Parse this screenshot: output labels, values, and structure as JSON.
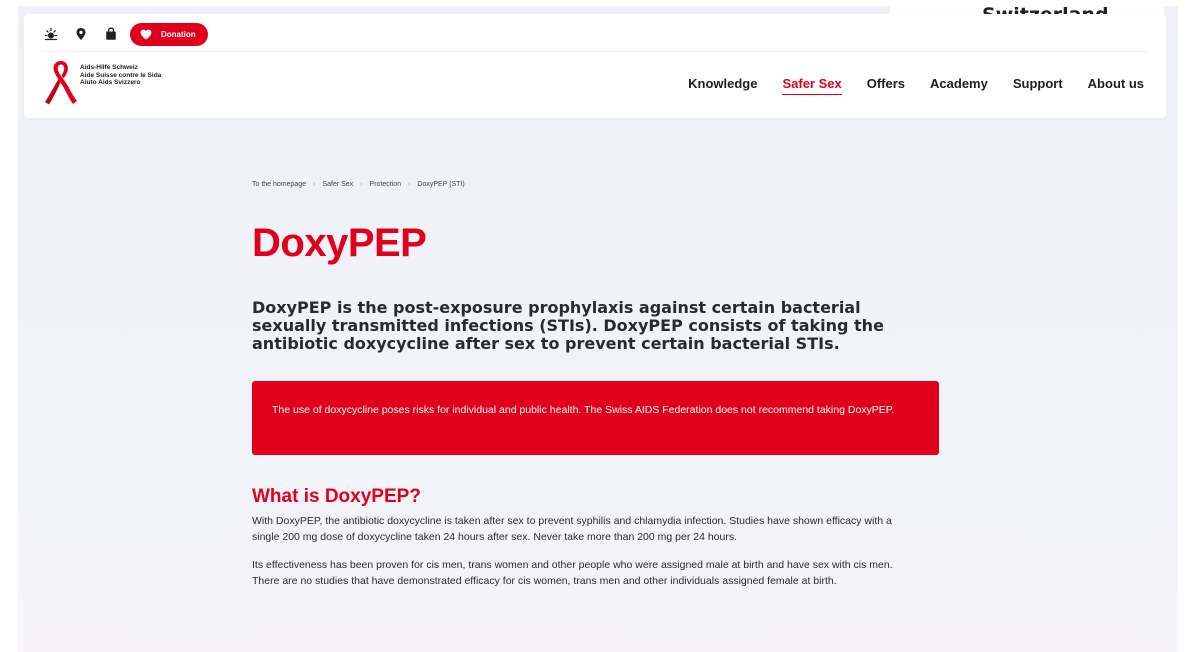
{
  "corner": {
    "label": "Switzerland"
  },
  "header": {
    "utility": {
      "icons": [
        "sun-icon",
        "location-pin-icon",
        "shopping-bag-icon"
      ],
      "donation_label": "Donation"
    },
    "logo": {
      "lines": [
        "Aids-Hilfe Schweiz",
        "Aide Suisse contre le Sida",
        "Aiuto Aids Svizzero"
      ]
    },
    "nav": [
      {
        "label": "Knowledge",
        "active": false
      },
      {
        "label": "Safer Sex",
        "active": true
      },
      {
        "label": "Offers",
        "active": false
      },
      {
        "label": "Academy",
        "active": false
      },
      {
        "label": "Support",
        "active": false
      },
      {
        "label": "About us",
        "active": false
      }
    ]
  },
  "breadcrumb": [
    "To the homepage",
    "Safer Sex",
    "Protection",
    "DoxyPEP (STI)"
  ],
  "page_title": "DoxyPEP",
  "lead": "DoxyPEP is the post-exposure prophylaxis against certain bacterial sexually transmitted infections (STIs). DoxyPEP consists of taking the antibiotic doxycycline after sex to prevent certain bacterial STIs.",
  "warning": "The use of doxycycline poses risks for individual and public health. The Swiss AIDS Federation does not recommend taking DoxyPEP.",
  "section": {
    "heading": "What is DoxyPEP?",
    "paragraphs": [
      "With DoxyPEP, the antibiotic doxycycline is taken after sex to prevent syphilis and chlamydia infection. Studies have shown efficacy with a single 200 mg dose of doxycycline taken 24 hours after sex. Never take more than 200 mg per 24 hours.",
      "Its effectiveness has been proven for cis men, trans women and other people who were assigned male at birth and have sex with cis men. There are no studies that have demonstrated efficacy for cis women, trans men and other individuals assigned female at birth."
    ]
  },
  "colors": {
    "brand_red": "#e0001b",
    "text": "#1e1e1e",
    "background": "#eef2f8"
  }
}
